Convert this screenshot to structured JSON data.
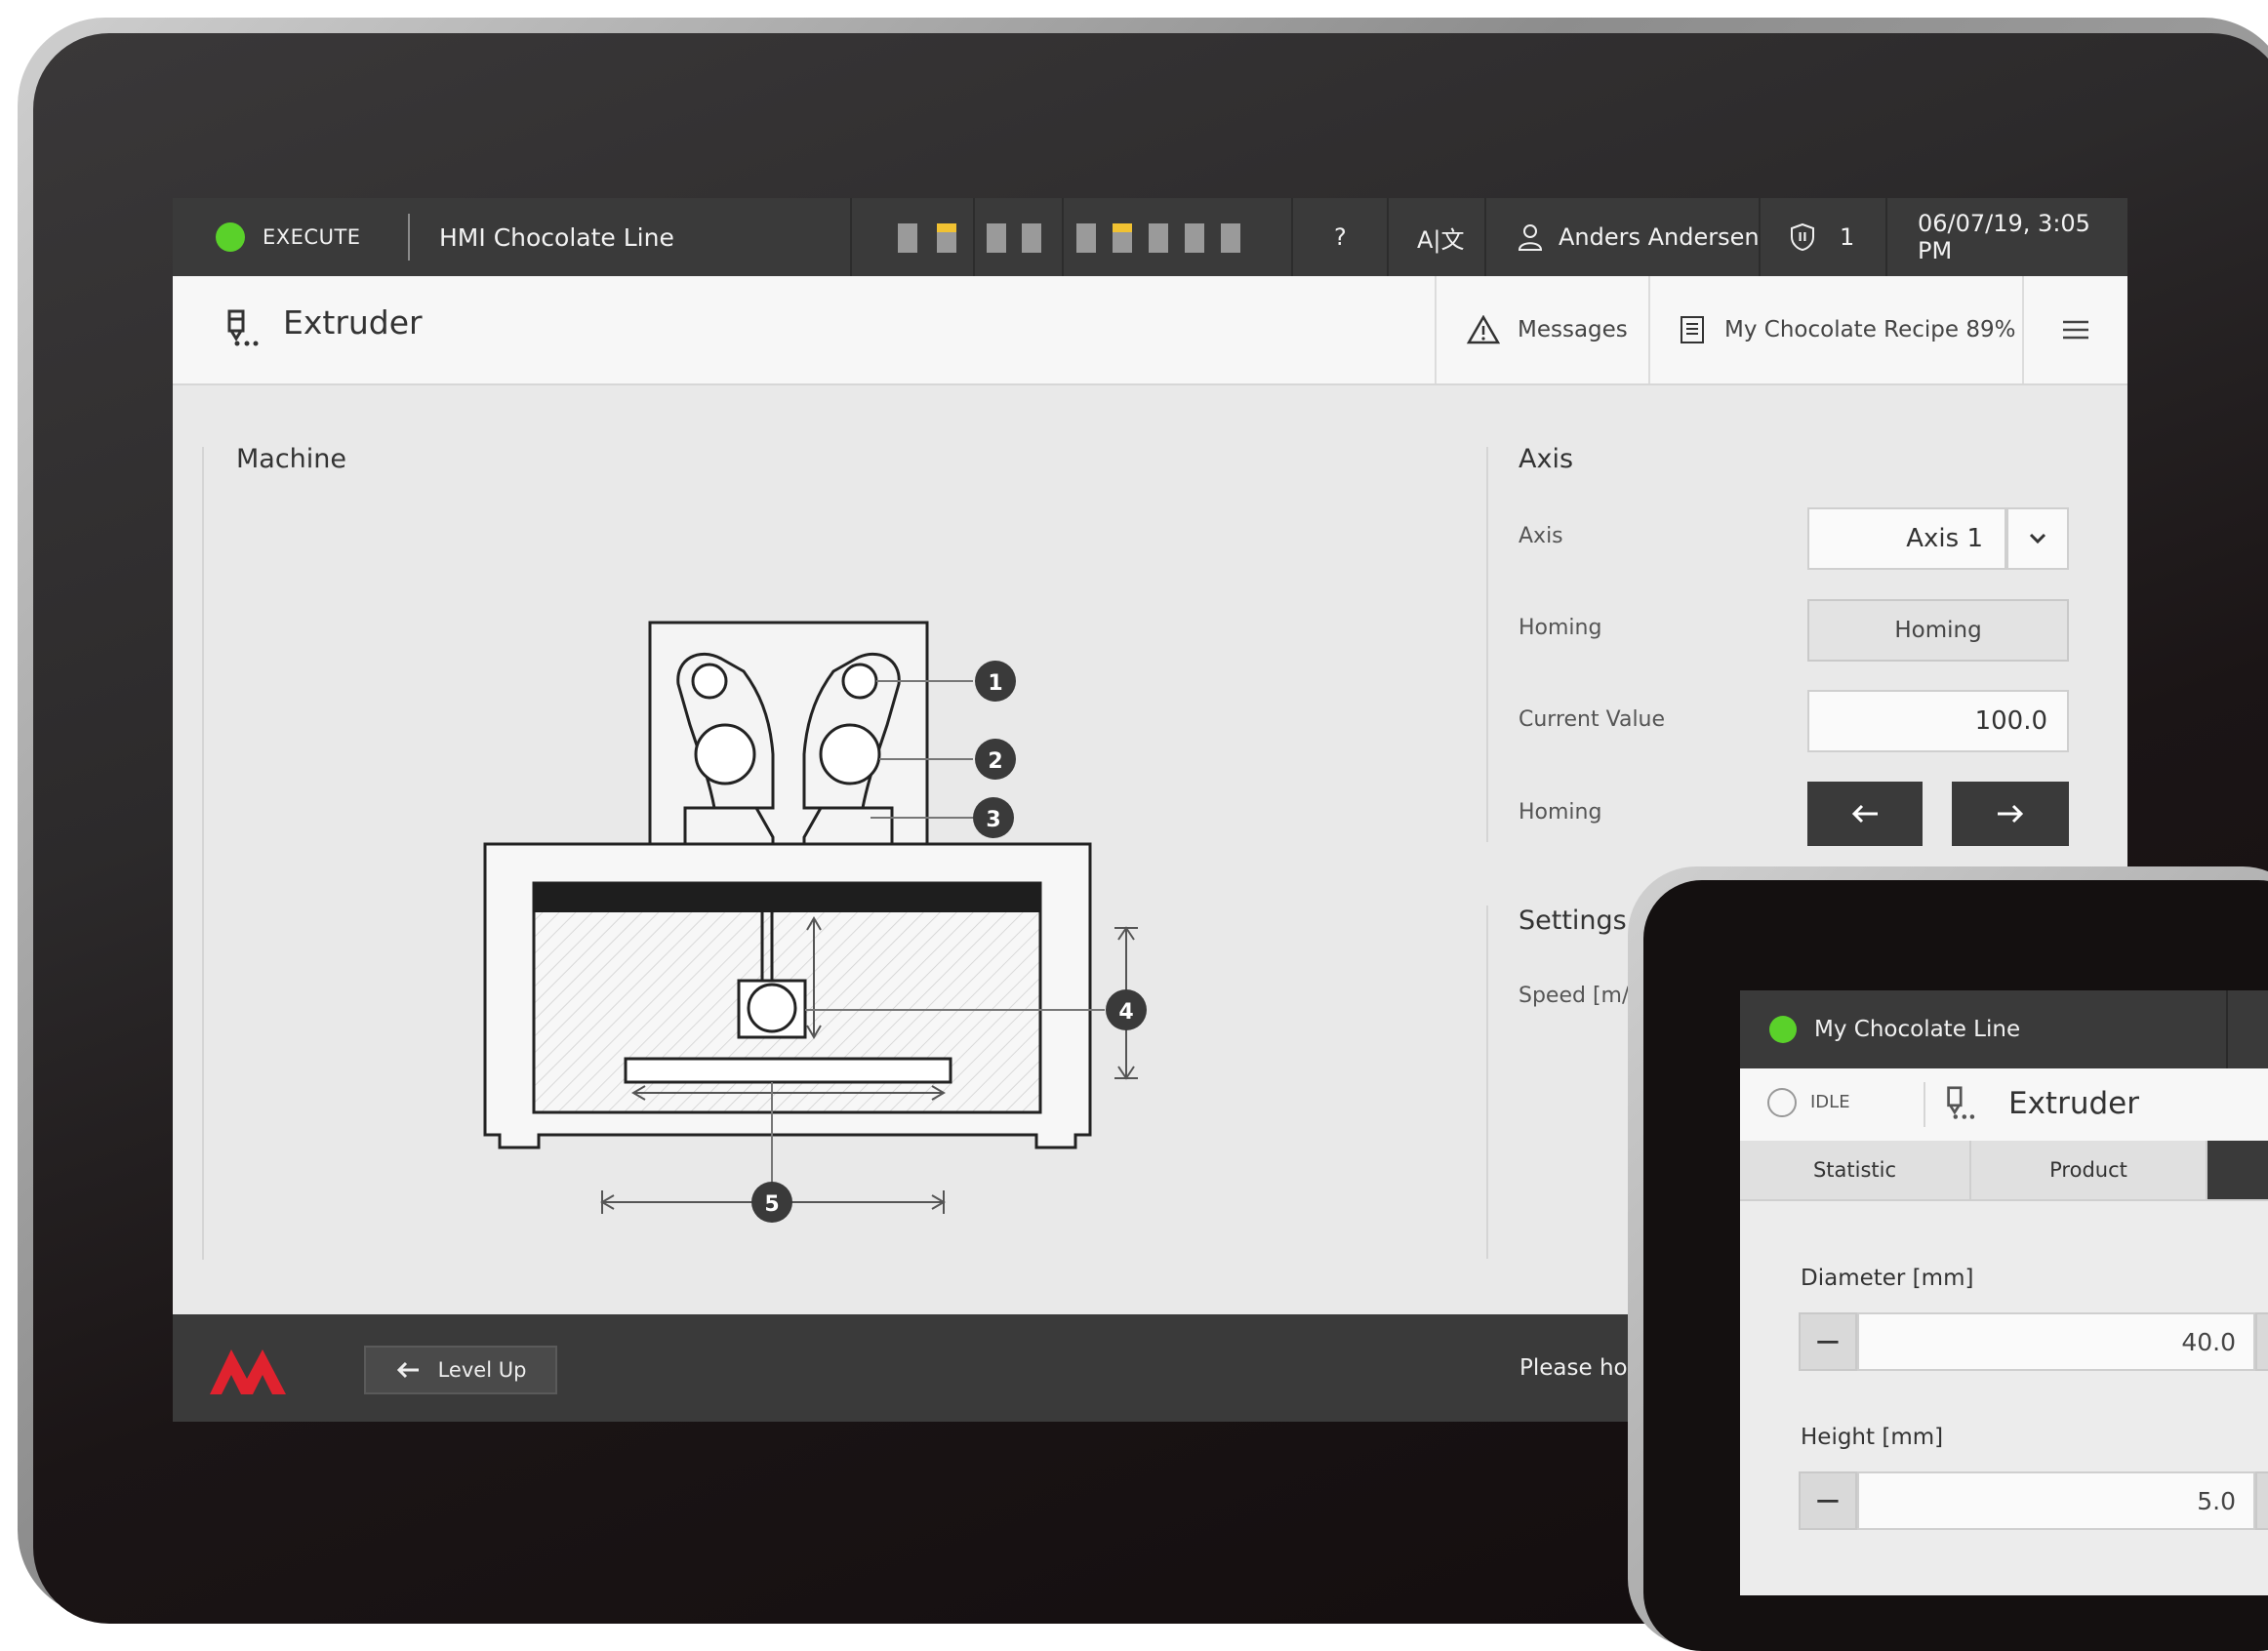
{
  "status_bar": {
    "mode": "EXECUTE",
    "app_title": "HMI Chocolate Line",
    "help": "?",
    "language": "A|文",
    "user": "Anders Andersen",
    "access_level": "1",
    "datetime": "06/07/19, 3:05 PM"
  },
  "header": {
    "title": "Extruder",
    "messages_label": "Messages",
    "recipe_label": "My Chocolate Recipe 89%"
  },
  "machine": {
    "title": "Machine",
    "callouts": [
      "1",
      "2",
      "3",
      "4",
      "5"
    ]
  },
  "axis_panel": {
    "title": "Axis",
    "axis_label": "Axis",
    "axis_value": "Axis 1",
    "homing_label": "Homing",
    "homing_button": "Homing",
    "current_value_label": "Current Value",
    "current_value": "100.0",
    "jog_label": "Homing"
  },
  "settings_panel": {
    "title": "Settings",
    "speed_label": "Speed [m/r"
  },
  "footer": {
    "level_up_label": "Level Up",
    "message": "Please hol"
  },
  "second_device": {
    "line_name": "My Chocolate Line",
    "state": "IDLE",
    "title": "Extruder",
    "tabs": [
      "Statistic",
      "Product"
    ],
    "fields": [
      {
        "label": "Diameter [mm]",
        "value": "40.0"
      },
      {
        "label": "Height [mm]",
        "value": "5.0"
      }
    ]
  },
  "colors": {
    "status_ok": "#5ad12a",
    "status_bar_bg": "#3a3a3a",
    "brand_red": "#e0222e",
    "highlight_yellow": "#f1c232"
  }
}
